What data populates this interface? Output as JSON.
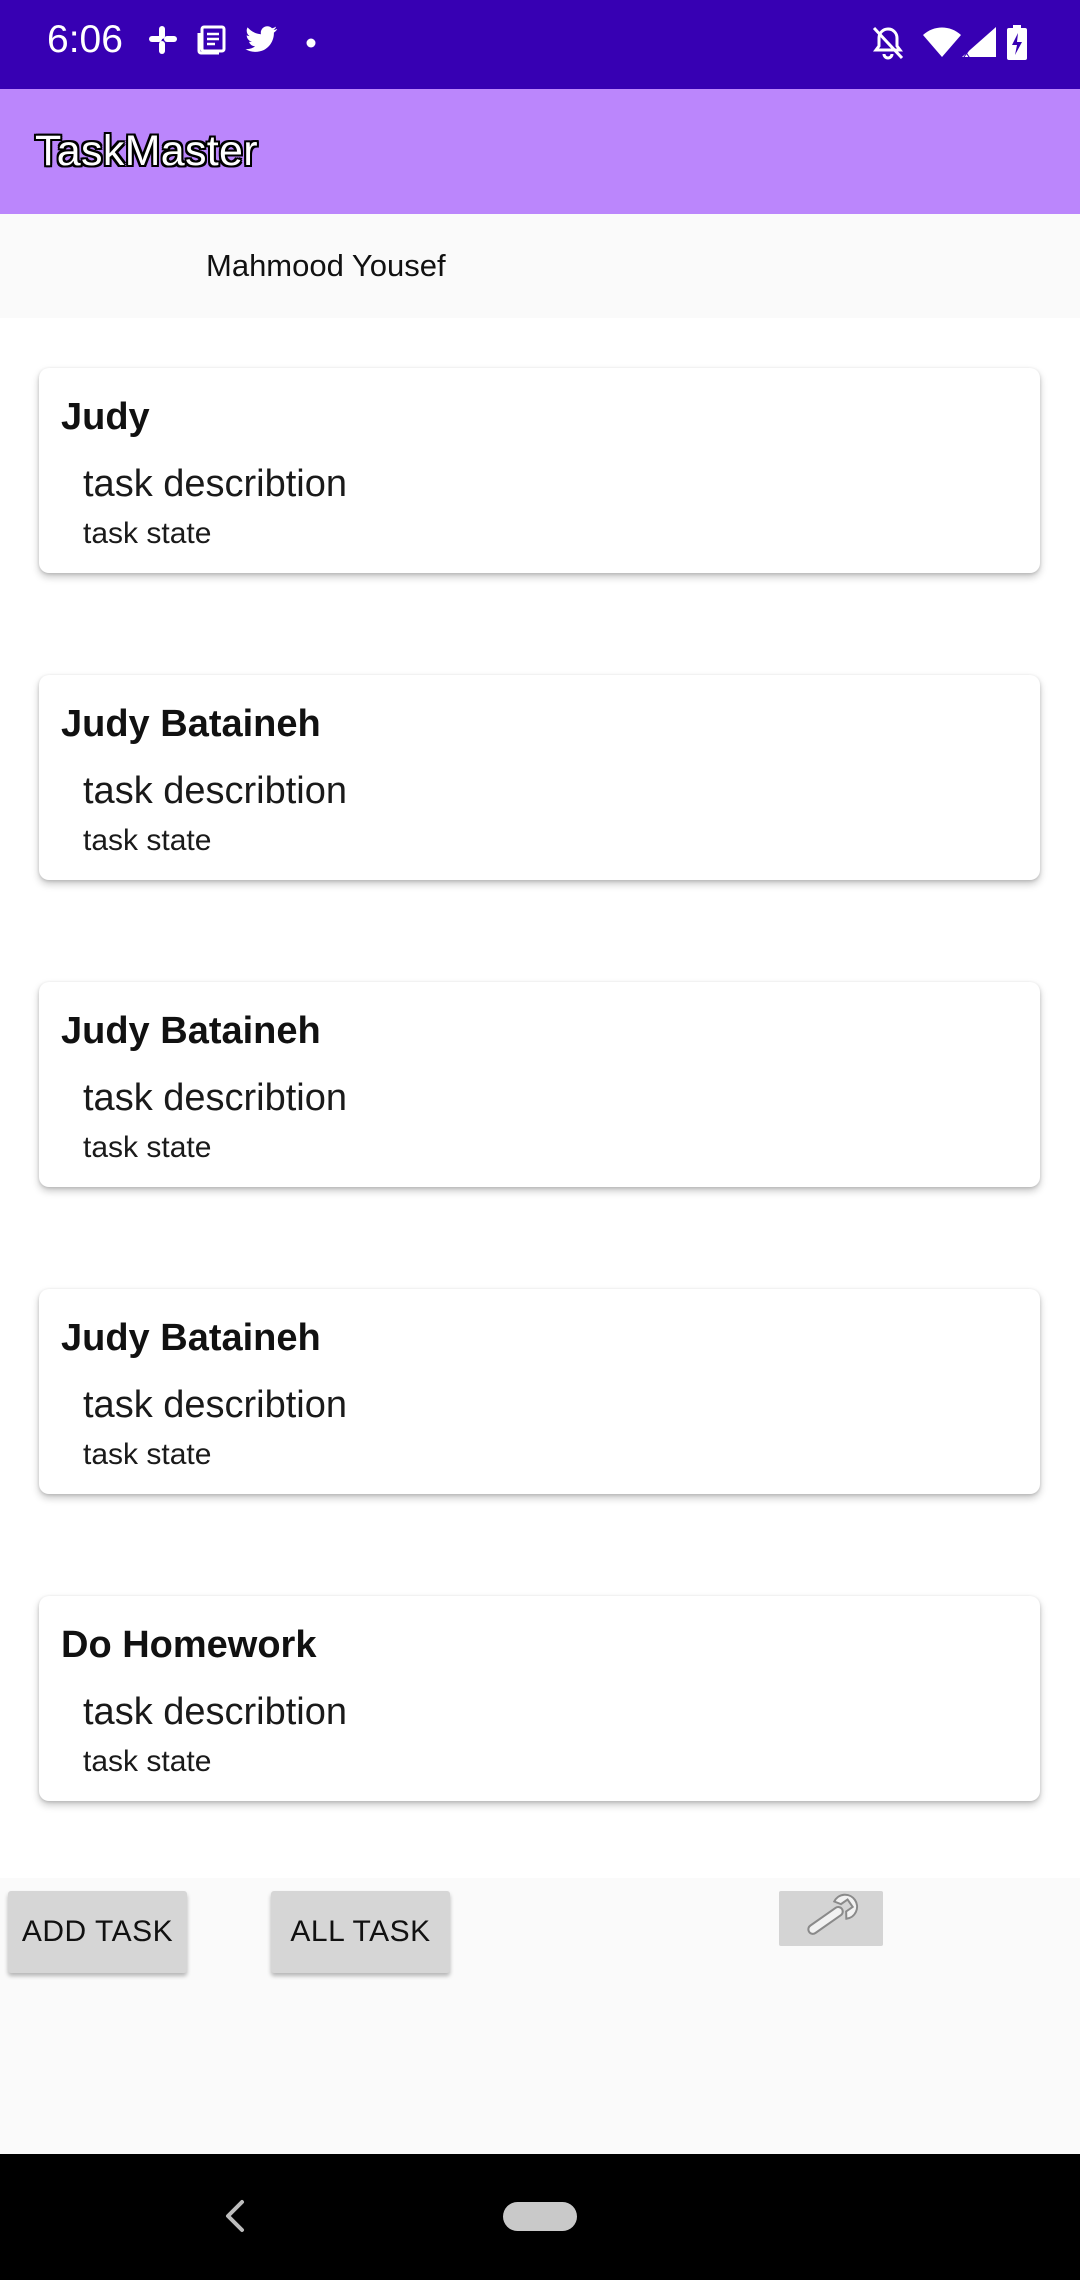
{
  "status_bar": {
    "time": "6:06",
    "left_icons": [
      "slack-icon",
      "news-icon",
      "twitter-icon",
      "dot-icon"
    ],
    "right_icons": [
      "notifications-off-icon",
      "wifi-icon",
      "signal-icon",
      "battery-charging-icon"
    ],
    "background_color": "#3700b3"
  },
  "app_bar": {
    "title": "TaskMaster",
    "background_color": "#bb86fc"
  },
  "user": {
    "name": "Mahmood Yousef"
  },
  "tasks": [
    {
      "title": "Judy",
      "description": "task describtion",
      "state": "task state"
    },
    {
      "title": "Judy Bataineh",
      "description": "task describtion",
      "state": "task state"
    },
    {
      "title": "Judy Bataineh",
      "description": "task describtion",
      "state": "task state"
    },
    {
      "title": "Judy Bataineh",
      "description": "task describtion",
      "state": "task state"
    },
    {
      "title": "Do Homework",
      "description": "task describtion",
      "state": "task state"
    }
  ],
  "actions": {
    "add_task_label": "ADD TASK",
    "all_task_label": "ALL TASK",
    "settings_icon": "wrench-icon"
  },
  "nav_bar": {
    "back_icon": "back-chevron-icon",
    "home_icon": "home-pill-icon"
  }
}
